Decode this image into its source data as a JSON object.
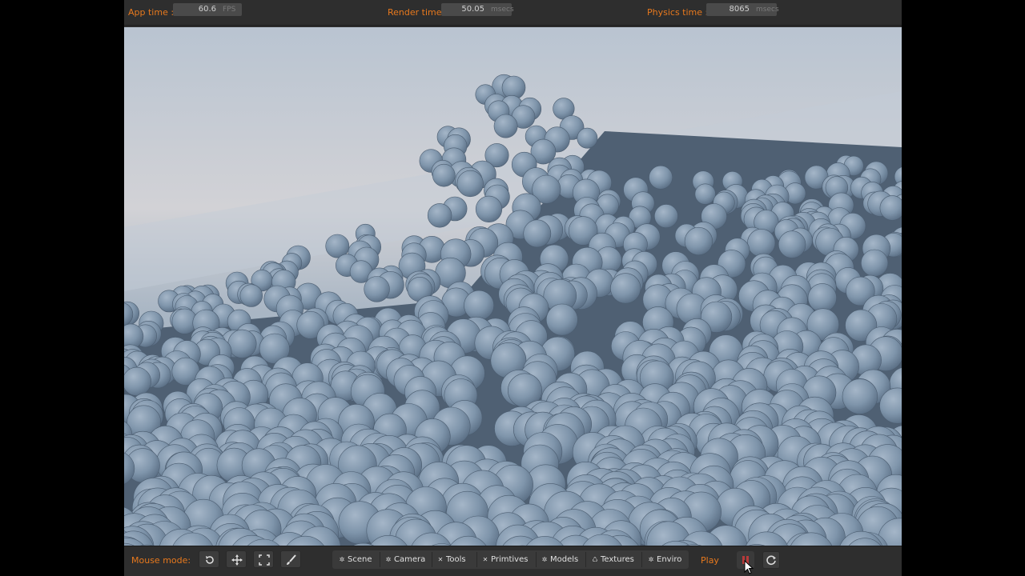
{
  "stats": {
    "app_time_label": "App time :",
    "app_time_value": "60.6",
    "app_time_unit": "FPS",
    "render_time_label": "Render time:",
    "render_time_value": "50.05",
    "render_time_unit": "msecs",
    "physics_time_label": "Physics time :",
    "physics_time_value": "8065",
    "physics_time_unit": "msecs"
  },
  "toolbar": {
    "mouse_mode_label": "Mouse mode:",
    "mode_icons": [
      "rotate-icon",
      "move-icon",
      "fit-icon",
      "brush-icon"
    ],
    "tabs": [
      {
        "label": "Scene",
        "icon": "scene-icon"
      },
      {
        "label": "Camera",
        "icon": "camera-icon"
      },
      {
        "label": "Tools",
        "icon": "tools-icon"
      },
      {
        "label": "Primtives",
        "icon": "primitives-icon"
      },
      {
        "label": "Models",
        "icon": "models-icon"
      },
      {
        "label": "Textures",
        "icon": "textures-icon"
      },
      {
        "label": "Enviro",
        "icon": "enviro-icon"
      }
    ],
    "play_label": "Play",
    "pause_icon": "pause-icon",
    "reset_icon": "reset-icon"
  },
  "viewport": {
    "scene": "pile of soft-body spheres",
    "sphere_color": "#7f95ab",
    "sky_color": "#b5c0cc"
  },
  "colors": {
    "accent": "#e8791d",
    "panel": "#2e2e2e"
  }
}
